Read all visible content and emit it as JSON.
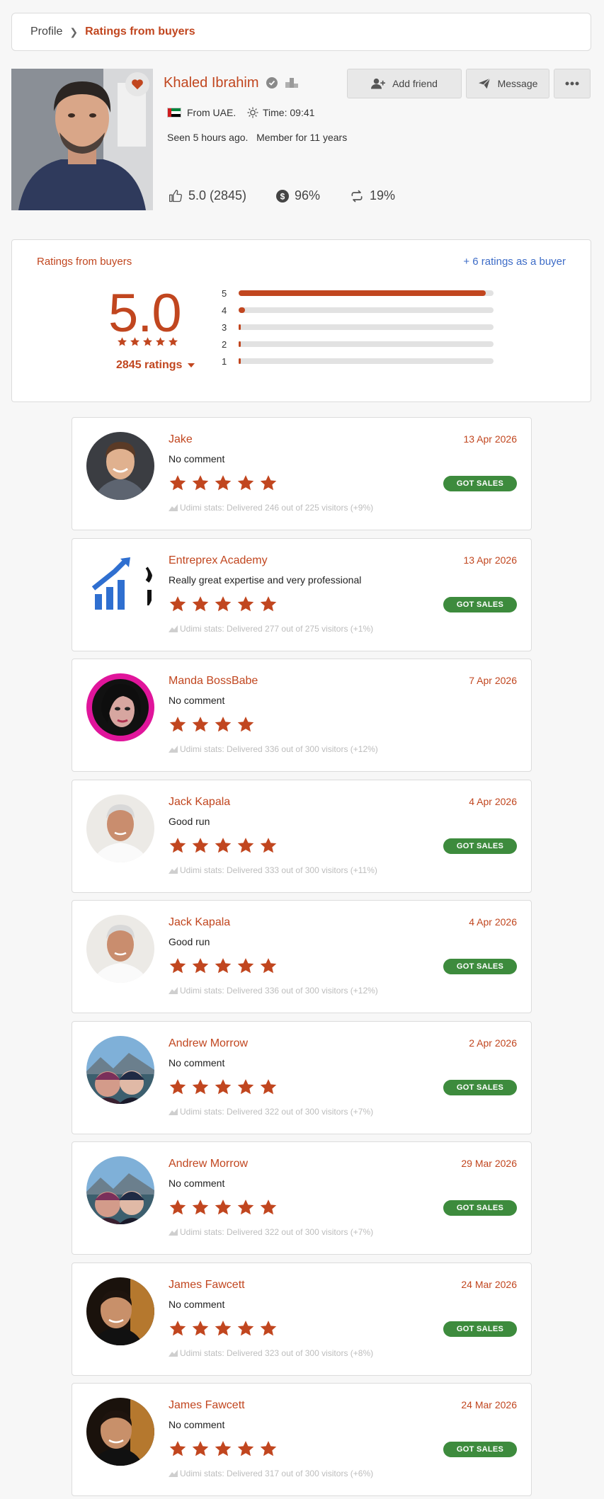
{
  "breadcrumb": {
    "profile": "Profile",
    "current": "Ratings from buyers"
  },
  "profile": {
    "name": "Khaled Ibrahim",
    "from": "From UAE.",
    "time": "Time: 09:41",
    "seen": "Seen 5 hours ago.   Member for 11 years",
    "rating": "5.0 (2845)",
    "sales_pct": "96%",
    "repeat_pct": "19%"
  },
  "actions": {
    "add_friend": "Add friend",
    "message": "Message"
  },
  "summary": {
    "title": "Ratings from buyers",
    "extra": "+ 6 ratings as a buyer",
    "score": "5.0",
    "count_label": "2845 ratings",
    "bars": [
      {
        "label": "5",
        "fraction": 0.97
      },
      {
        "label": "4",
        "fraction": 0.025
      },
      {
        "label": "3",
        "fraction": 0.005
      },
      {
        "label": "2",
        "fraction": 0.005
      },
      {
        "label": "1",
        "fraction": 0.005
      }
    ]
  },
  "colors": {
    "accent": "#c1461f",
    "link": "#3d6cc7",
    "success": "#3d8b3d"
  },
  "reviews": [
    {
      "name": "Jake",
      "date": "13 Apr 2026",
      "comment": "No comment",
      "stars": 5,
      "got_sales": "GOT SALES",
      "stats": "Udimi stats: Delivered 246 out of 225 visitors (+9%)"
    },
    {
      "name": "Entreprex Academy",
      "date": "13 Apr 2026",
      "comment": "Really great expertise and very professional",
      "stars": 5,
      "got_sales": "GOT SALES",
      "stats": "Udimi stats: Delivered 277 out of 275 visitors (+1%)"
    },
    {
      "name": "Manda BossBabe",
      "date": "7 Apr 2026",
      "comment": "No comment",
      "stars": 4,
      "got_sales": "",
      "stats": "Udimi stats: Delivered 336 out of 300 visitors (+12%)"
    },
    {
      "name": "Jack Kapala",
      "date": "4 Apr 2026",
      "comment": "Good run",
      "stars": 5,
      "got_sales": "GOT SALES",
      "stats": "Udimi stats: Delivered 333 out of 300 visitors (+11%)"
    },
    {
      "name": "Jack Kapala",
      "date": "4 Apr 2026",
      "comment": "Good run",
      "stars": 5,
      "got_sales": "GOT SALES",
      "stats": "Udimi stats: Delivered 336 out of 300 visitors (+12%)"
    },
    {
      "name": "Andrew Morrow",
      "date": "2 Apr 2026",
      "comment": "No comment",
      "stars": 5,
      "got_sales": "GOT SALES",
      "stats": "Udimi stats: Delivered 322 out of 300 visitors (+7%)"
    },
    {
      "name": "Andrew Morrow",
      "date": "29 Mar 2026",
      "comment": "No comment",
      "stars": 5,
      "got_sales": "GOT SALES",
      "stats": "Udimi stats: Delivered 322 out of 300 visitors (+7%)"
    },
    {
      "name": "James Fawcett",
      "date": "24 Mar 2026",
      "comment": "No comment",
      "stars": 5,
      "got_sales": "GOT SALES",
      "stats": "Udimi stats: Delivered 323 out of 300 visitors (+8%)"
    },
    {
      "name": "James Fawcett",
      "date": "24 Mar 2026",
      "comment": "No comment",
      "stars": 5,
      "got_sales": "GOT SALES",
      "stats": "Udimi stats: Delivered 317 out of 300 visitors (+6%)"
    }
  ]
}
